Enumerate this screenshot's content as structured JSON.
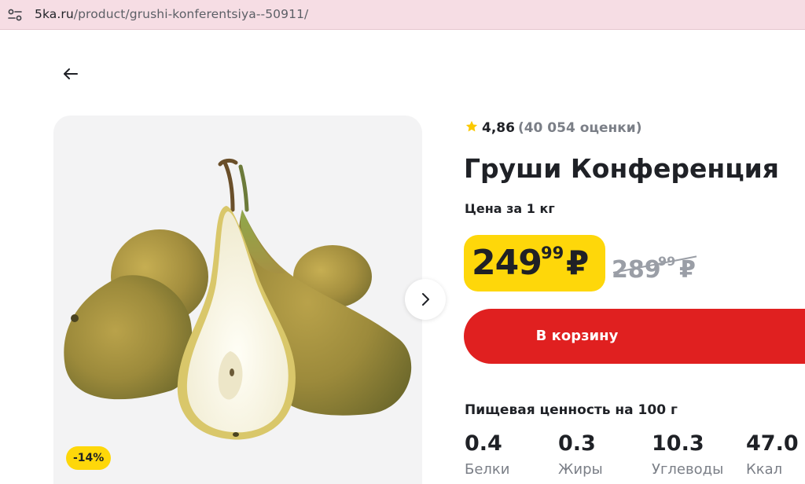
{
  "browser": {
    "url_host": "5ka.ru",
    "url_path": "/product/grushi-konferentsiya--50911/"
  },
  "product": {
    "rating": "4,86",
    "rating_count": "(40 054 оценки)",
    "title": "Груши Конференция",
    "price_unit": "Цена за 1 кг",
    "price": {
      "rubles": "249",
      "kopecks": "99",
      "currency": "₽"
    },
    "old_price": {
      "rubles": "289",
      "kopecks": "99",
      "currency": "₽"
    },
    "discount": "-14%",
    "cart_button": "В корзину"
  },
  "nutrition": {
    "title": "Пищевая ценность на 100 г",
    "items": [
      {
        "value": "0.4",
        "label": "Белки"
      },
      {
        "value": "0.3",
        "label": "Жиры"
      },
      {
        "value": "10.3",
        "label": "Углеводы"
      },
      {
        "value": "47.0",
        "label": "Ккал"
      }
    ]
  },
  "colors": {
    "accent_yellow": "#fed70a",
    "cart_red": "#e02020",
    "address_bar": "#f6dde4"
  },
  "icons": {
    "site_info": "tune-icon",
    "back": "arrow-left-icon",
    "next": "chevron-right-icon",
    "rating": "star-icon"
  }
}
